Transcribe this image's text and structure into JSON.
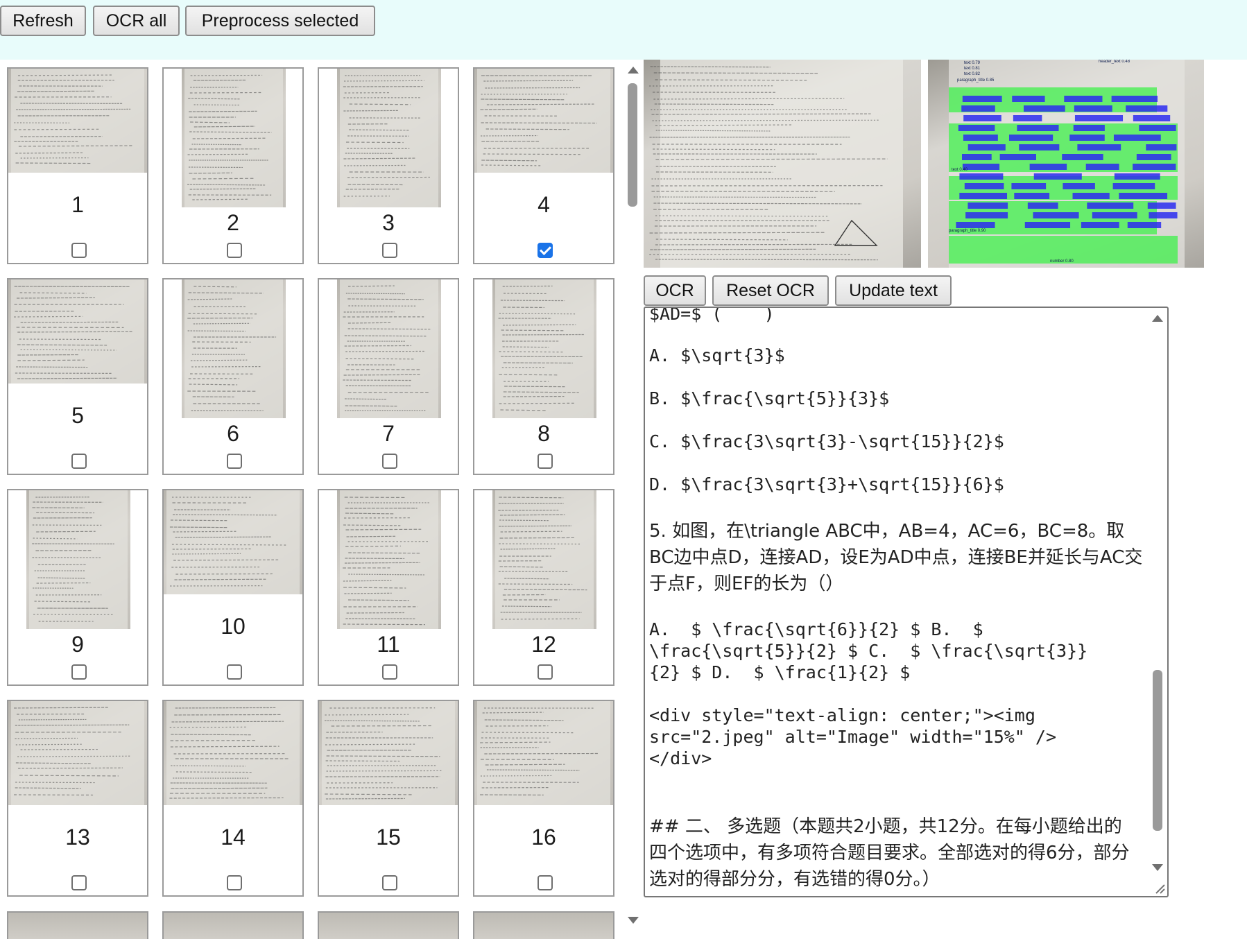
{
  "toolbar": {
    "refresh_label": "Refresh",
    "ocr_all_label": "OCR all",
    "preprocess_label": "Preprocess selected"
  },
  "thumbnails": [
    {
      "number": "1",
      "checked": false
    },
    {
      "number": "2",
      "checked": false
    },
    {
      "number": "3",
      "checked": false
    },
    {
      "number": "4",
      "checked": true
    },
    {
      "number": "5",
      "checked": false
    },
    {
      "number": "6",
      "checked": false
    },
    {
      "number": "7",
      "checked": false
    },
    {
      "number": "8",
      "checked": false
    },
    {
      "number": "9",
      "checked": false
    },
    {
      "number": "10",
      "checked": false
    },
    {
      "number": "11",
      "checked": false
    },
    {
      "number": "12",
      "checked": false
    },
    {
      "number": "13",
      "checked": false
    },
    {
      "number": "14",
      "checked": false
    },
    {
      "number": "15",
      "checked": false
    },
    {
      "number": "16",
      "checked": false
    }
  ],
  "preview": {
    "layout_labels": [
      "text 0.79",
      "text 0.81",
      "text 0.82",
      "paragraph_title 0.85",
      "text 0.40",
      "paragraph_title 0.90",
      "number 0.80",
      "header_text 0.48",
      "inline_formula 0.78",
      "inline_formula 0.92",
      "image 0.92"
    ]
  },
  "actions": {
    "ocr_label": "OCR",
    "reset_ocr_label": "Reset OCR",
    "update_text_label": "Update text"
  },
  "editor": {
    "lines": [
      "$AD=$ (    )",
      "A. $\\sqrt{3}$",
      "B. $\\frac{\\sqrt{5}}{3}$",
      "C. $\\frac{3\\sqrt{3}-\\sqrt{15}}{2}$",
      "D. $\\frac{3\\sqrt{3}+\\sqrt{15}}{6}$",
      "5. 如图，在\\triangle ABC中，AB=4，AC=6，BC=8。取",
      "BC边中点D，连接AD，设E为AD中点，连接BE并延长与AC交",
      "于点F，则EF的长为（）",
      "A.  $ \\frac{\\sqrt{6}}{2} $ B.  $",
      "\\frac{\\sqrt{5}}{2} $ C.  $ \\frac{\\sqrt{3}}",
      "{2} $ D.  $ \\frac{1}{2} $",
      "<div style=\"text-align: center;\"><img",
      "src=\"2.jpeg\" alt=\"Image\" width=\"15%\" />",
      "</div>",
      "## 二、 多选题（本题共2小题，共12分。在每小题给出的",
      "四个选项中，有多项符合题目要求。全部选对的得6分，部分",
      "选对的得部分分，有选错的得0分。）"
    ]
  },
  "colors": {
    "toolbar_bg": "#e8fcfb",
    "checkbox_checked": "#1a73e8",
    "layout_text_box": "#2b2bf0",
    "layout_formula_box": "#3df04a"
  }
}
